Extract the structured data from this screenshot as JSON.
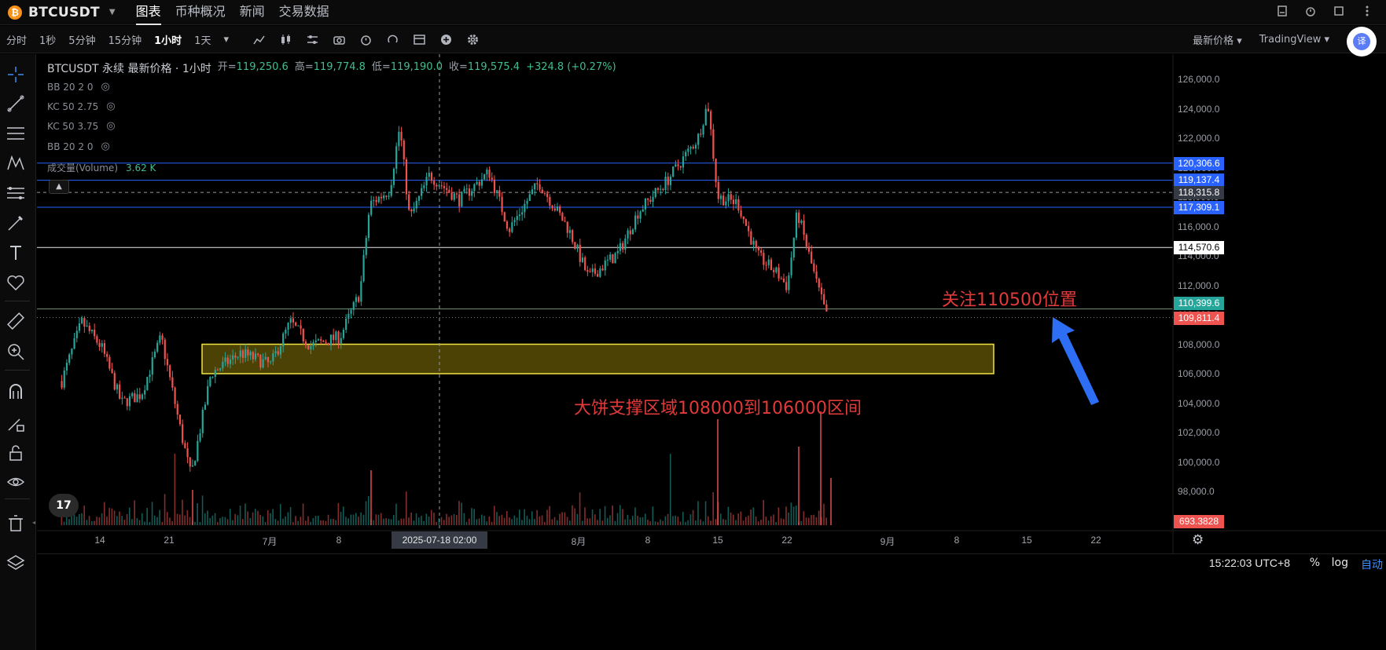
{
  "header": {
    "symbol": "BTCUSDT",
    "symbol_caret": "▼",
    "tabs": [
      "图表",
      "币种概况",
      "新闻",
      "交易数据"
    ],
    "active_tab": "图表"
  },
  "toolbar": {
    "intervals": [
      "分时",
      "1秒",
      "5分钟",
      "15分钟",
      "1小时",
      "1天"
    ],
    "active_interval": "1小时",
    "price_type": "最新价格",
    "view_mode": "TradingView",
    "translate_label": "译"
  },
  "legend": {
    "title": "BTCUSDT 永续 最新价格 · 1小时",
    "open_label": "开=",
    "open": "119,250.6",
    "high_label": "高=",
    "high": "119,774.8",
    "low_label": "低=",
    "low": "119,190.0",
    "close_label": "收=",
    "close": "119,575.4",
    "change": "+324.8 (+0.27%)",
    "indicators": [
      "BB 20 2 0",
      "KC 50 2.75",
      "KC 50 3.75",
      "BB 20 2 0"
    ],
    "volume_label": "成交量(Volume)",
    "volume_value": "3.62 K"
  },
  "price_axis": {
    "ticks": [
      "126,000.0",
      "124,000.0",
      "122,000.0",
      "120,000.0",
      "118,000.0",
      "116,000.0",
      "114,000.0",
      "112,000.0",
      "110,000.0",
      "108,000.0",
      "106,000.0",
      "104,000.0",
      "102,000.0",
      "100,000.0",
      "98,000.0"
    ],
    "tags": {
      "level1": "120,306.6",
      "level2": "119,137.4",
      "crosshair": "118,315.8",
      "level3": "117,309.1",
      "level4": "114,570.6",
      "level5": "110,399.6",
      "last_price": "109,811.4",
      "volume": "693.3828"
    }
  },
  "time_axis": {
    "labels": [
      "14",
      "21",
      "7月",
      "8",
      "8月",
      "8",
      "15",
      "22",
      "9月",
      "8",
      "15",
      "22"
    ],
    "crosshair_time": "2025-07-18  02:00"
  },
  "bottom_bar": {
    "clock": "15:22:03 UTC+8",
    "percent": "%",
    "log": "log",
    "auto": "自动"
  },
  "annotations": {
    "focus": "关注110500位置",
    "support": "大饼支撑区域108000到106000区间"
  },
  "colors": {
    "up": "#26a69a",
    "down": "#ef5350",
    "blue_level": "#2962ff",
    "support_box": "#f0e442",
    "annotation": "#e03a3a",
    "arrow": "#2d6ef5"
  },
  "chart_data": {
    "type": "candlestick",
    "title": "BTCUSDT 永续 最新价格 · 1小时",
    "y_range": [
      97000,
      127000
    ],
    "x_range": [
      "2025-06-10",
      "2025-09-25"
    ],
    "price_path": [
      [
        "2025-06-10",
        105500
      ],
      [
        "2025-06-12",
        109500
      ],
      [
        "2025-06-14",
        107800
      ],
      [
        "2025-06-16",
        104000
      ],
      [
        "2025-06-18",
        104600
      ],
      [
        "2025-06-20",
        108500
      ],
      [
        "2025-06-22",
        102000
      ],
      [
        "2025-06-23",
        99000
      ],
      [
        "2025-06-25",
        106000
      ],
      [
        "2025-06-28",
        107400
      ],
      [
        "2025-07-01",
        106600
      ],
      [
        "2025-07-03",
        109500
      ],
      [
        "2025-07-05",
        107900
      ],
      [
        "2025-07-08",
        108500
      ],
      [
        "2025-07-10",
        111500
      ],
      [
        "2025-07-11",
        117500
      ],
      [
        "2025-07-13",
        118500
      ],
      [
        "2025-07-14",
        122800
      ],
      [
        "2025-07-15",
        116500
      ],
      [
        "2025-07-17",
        119500
      ],
      [
        "2025-07-20",
        117800
      ],
      [
        "2025-07-23",
        119700
      ],
      [
        "2025-07-25",
        115800
      ],
      [
        "2025-07-28",
        119000
      ],
      [
        "2025-07-31",
        115800
      ],
      [
        "2025-08-02",
        112500
      ],
      [
        "2025-08-05",
        114200
      ],
      [
        "2025-08-07",
        117000
      ],
      [
        "2025-08-10",
        119200
      ],
      [
        "2025-08-13",
        122000
      ],
      [
        "2025-08-14",
        124400
      ],
      [
        "2025-08-15",
        118000
      ],
      [
        "2025-08-17",
        117600
      ],
      [
        "2025-08-19",
        114000
      ],
      [
        "2025-08-21",
        112800
      ],
      [
        "2025-08-22",
        111900
      ],
      [
        "2025-08-23",
        117000
      ],
      [
        "2025-08-25",
        112000
      ],
      [
        "2025-08-26",
        109800
      ]
    ],
    "horizontal_levels": [
      120306.6,
      119137.4,
      117309.1,
      114570.6,
      110399.6,
      109811.4
    ],
    "support_zone": [
      106000,
      108000
    ],
    "crosshair": {
      "time": "2025-07-18 02:00",
      "price": 118315.8
    }
  }
}
